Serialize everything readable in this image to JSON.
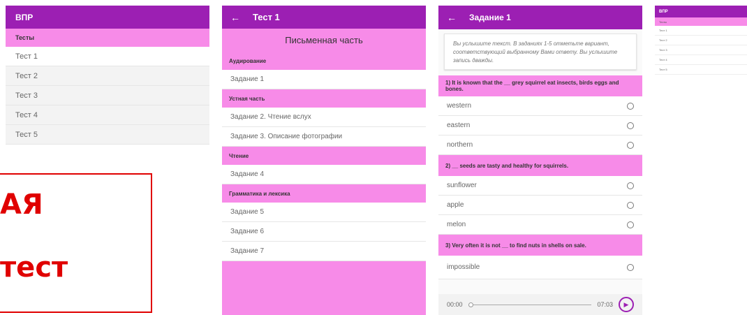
{
  "panel1": {
    "title": "ВПР",
    "section": "Тесты",
    "items": [
      "Тест 1",
      "Тест 2",
      "Тест 3",
      "Тест 4",
      "Тест 5"
    ]
  },
  "promo": {
    "line1": "АЯ",
    "line2": "тест"
  },
  "panel2": {
    "back_icon": "arrow-left-icon",
    "title": "Тест 1",
    "heading": "Письменная часть",
    "sections": [
      {
        "header": "Аудирование",
        "items": [
          "Задание 1"
        ]
      },
      {
        "header": "Устная часть",
        "items": [
          "Задание 2. Чтение вслух",
          "Задание 3. Описание фотографии"
        ]
      },
      {
        "header": "Чтение",
        "items": [
          "Задание 4"
        ]
      },
      {
        "header": "Грамматика и лексика",
        "items": [
          "Задание 5",
          "Задание 6",
          "Задание 7"
        ]
      }
    ]
  },
  "panel3": {
    "back_icon": "arrow-left-icon",
    "title": "Задание 1",
    "instruction": "Вы услышите текст. В заданиях 1-5 отметьте вариант, соответствующий выбранному Вами ответу. Вы услышите запись дважды.",
    "questions": [
      {
        "text": "1)  It is known that the __ grey squirrel eat insects, birds eggs and bones.",
        "options": [
          "western",
          "eastern",
          "northern"
        ]
      },
      {
        "text": "2)  __ seeds are tasty and healthy for squirrels.",
        "options": [
          "sunflower",
          "apple",
          "melon"
        ]
      },
      {
        "text": "3)  Very often it is not __ to find nuts in shells on sale.",
        "options": [
          "impossible"
        ]
      }
    ],
    "player": {
      "current": "00:00",
      "duration": "07:03",
      "play_icon": "play-icon"
    }
  },
  "panel4": {
    "title": "ВПР",
    "section": "Тесты",
    "items": [
      "Тест 1",
      "Тест 2",
      "Тест 3",
      "Тест 4",
      "Тест 5"
    ]
  },
  "colors": {
    "primary": "#9c1fb3",
    "accent_pink": "#f78be8",
    "promo_red": "#e00000"
  }
}
